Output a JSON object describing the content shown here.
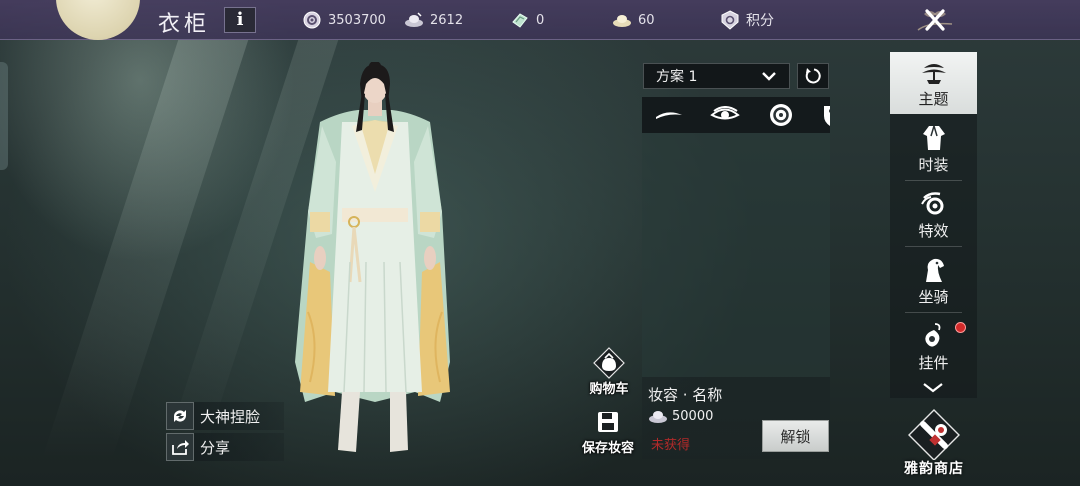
{
  "topbar": {
    "title": "衣柜",
    "info_label": "i",
    "currencies": [
      {
        "icon": "coin-icon",
        "value": "3503700"
      },
      {
        "icon": "silver-ingot-icon",
        "value": "2612"
      },
      {
        "icon": "jade-icon",
        "value": "0"
      },
      {
        "icon": "gold-ingot-icon",
        "value": "60"
      },
      {
        "icon": "points-badge-icon",
        "value": "积分"
      }
    ],
    "close_icon": "close-icon"
  },
  "left_actions": [
    {
      "icon": "refresh-icon",
      "label": "大神捏脸"
    },
    {
      "icon": "share-icon",
      "label": "分享"
    }
  ],
  "makeup_panel": {
    "plan_selected": "方案 1",
    "part_icons": [
      "eyebrow-icon",
      "eye-icon",
      "lip-icon",
      "face-paint-icon"
    ],
    "item_name": "妆容 · 名称",
    "price": "50000",
    "status": "未获得",
    "unlock_label": "解锁"
  },
  "floating_buttons": [
    {
      "icon": "cart-bag-icon",
      "label": "购物车"
    },
    {
      "icon": "save-disk-icon",
      "label": "保存妆容"
    }
  ],
  "sidebar": {
    "items": [
      {
        "icon": "bonsai-icon",
        "label": "主题",
        "active": true
      },
      {
        "icon": "robe-icon",
        "label": "时装",
        "active": false
      },
      {
        "icon": "swirl-icon",
        "label": "特效",
        "active": false
      },
      {
        "icon": "horse-icon",
        "label": "坐骑",
        "active": false
      },
      {
        "icon": "pendant-icon",
        "label": "挂件",
        "active": false,
        "badge": true
      }
    ],
    "shop_label": "雅韵商店"
  },
  "colors": {
    "topbar": "#463c5f",
    "status_red": "#b12a2a",
    "active_tab": "#f2f4f3"
  }
}
